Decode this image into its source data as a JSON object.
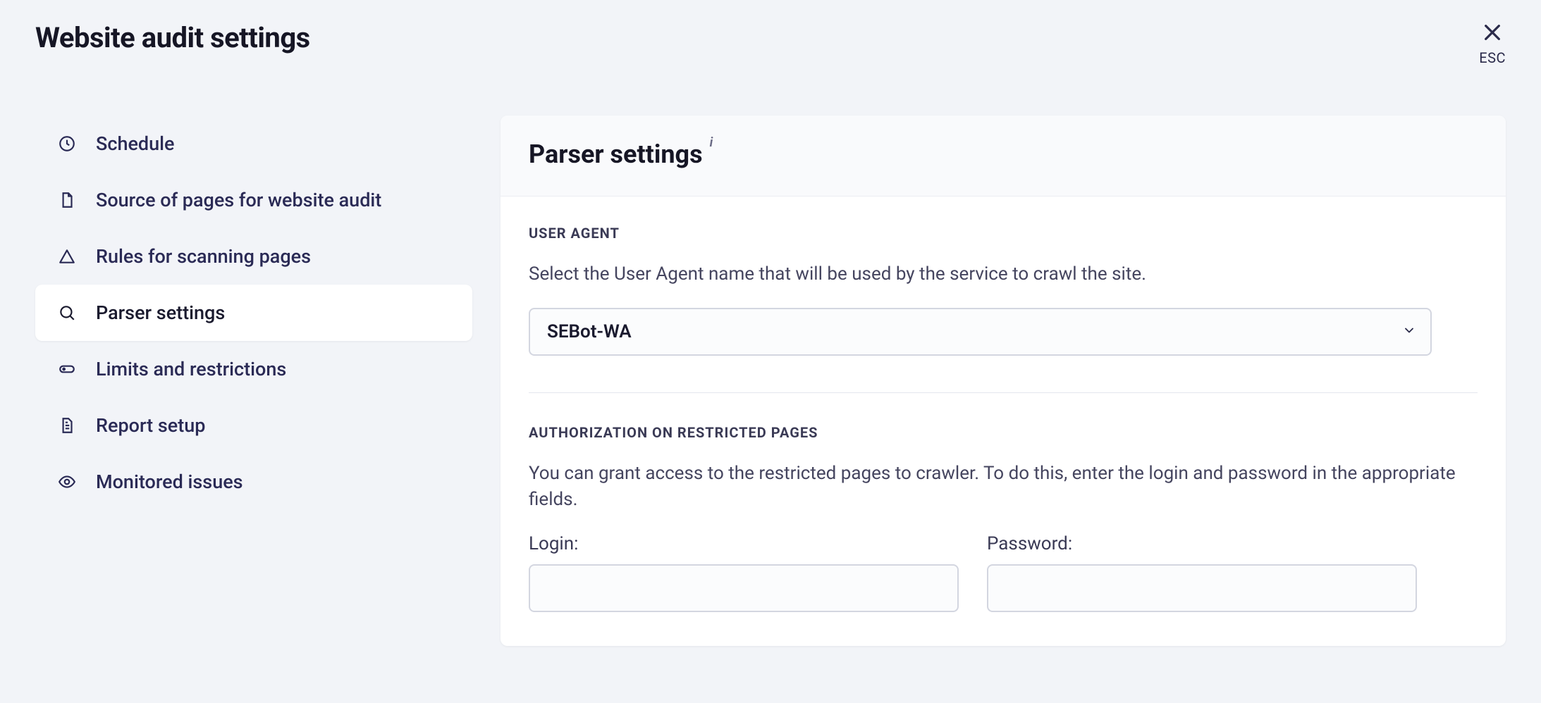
{
  "header": {
    "title": "Website audit settings",
    "close_label": "ESC"
  },
  "sidebar": {
    "items": [
      {
        "id": "schedule",
        "label": "Schedule",
        "icon": "clock-icon",
        "active": false
      },
      {
        "id": "source",
        "label": "Source of pages for website audit",
        "icon": "page-icon",
        "active": false
      },
      {
        "id": "rules",
        "label": "Rules for scanning pages",
        "icon": "triangle-icon",
        "active": false
      },
      {
        "id": "parser",
        "label": "Parser settings",
        "icon": "magnifier-icon",
        "active": true
      },
      {
        "id": "limits",
        "label": "Limits and restrictions",
        "icon": "toggle-icon",
        "active": false
      },
      {
        "id": "report",
        "label": "Report setup",
        "icon": "report-icon",
        "active": false
      },
      {
        "id": "monitored",
        "label": "Monitored issues",
        "icon": "eye-icon",
        "active": false
      }
    ]
  },
  "panel": {
    "title": "Parser settings",
    "info_glyph": "i",
    "user_agent_section": {
      "label": "USER AGENT",
      "description": "Select the User Agent name that will be used by the service to crawl the site.",
      "selected": "SEBot-WA"
    },
    "auth_section": {
      "label": "AUTHORIZATION ON RESTRICTED PAGES",
      "description": "You can grant access to the restricted pages to crawler. To do this, enter the login and password in the appropriate fields.",
      "login_label": "Login:",
      "login_value": "",
      "password_label": "Password:",
      "password_value": ""
    }
  }
}
